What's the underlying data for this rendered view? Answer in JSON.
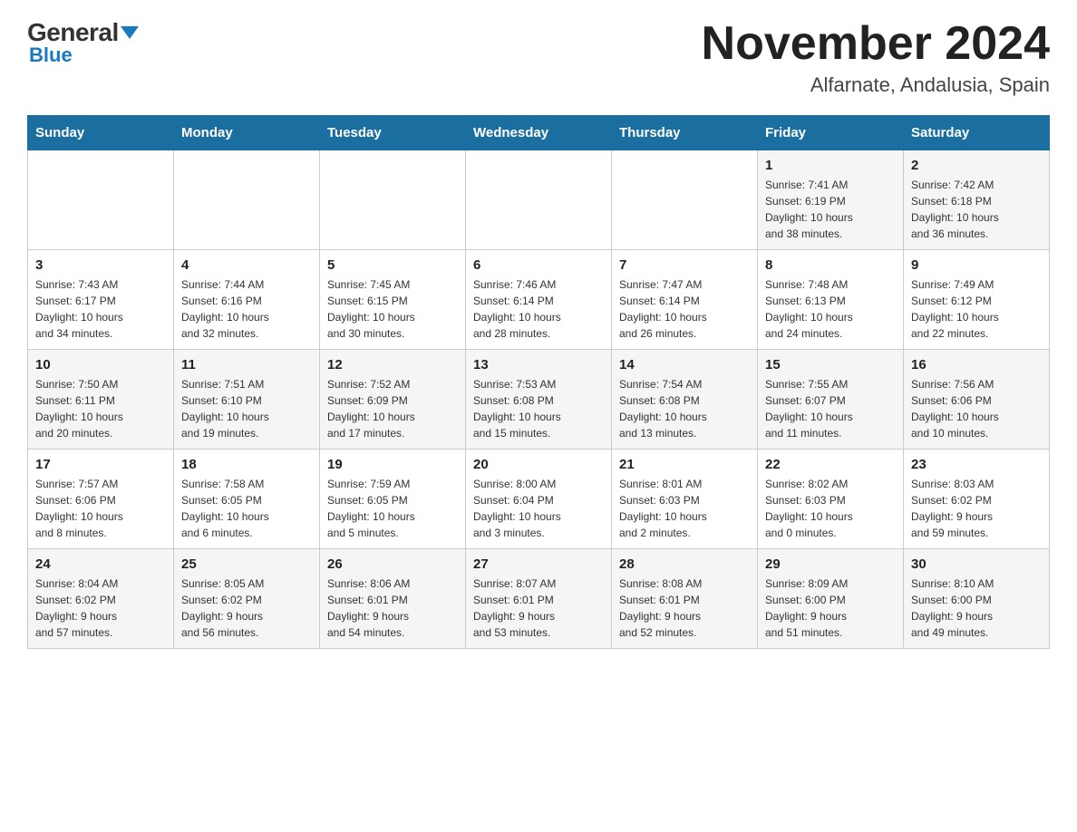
{
  "header": {
    "logo_top": "General",
    "logo_bottom": "Blue",
    "title": "November 2024",
    "subtitle": "Alfarnate, Andalusia, Spain"
  },
  "weekdays": [
    "Sunday",
    "Monday",
    "Tuesday",
    "Wednesday",
    "Thursday",
    "Friday",
    "Saturday"
  ],
  "weeks": [
    [
      {
        "day": "",
        "info": ""
      },
      {
        "day": "",
        "info": ""
      },
      {
        "day": "",
        "info": ""
      },
      {
        "day": "",
        "info": ""
      },
      {
        "day": "",
        "info": ""
      },
      {
        "day": "1",
        "info": "Sunrise: 7:41 AM\nSunset: 6:19 PM\nDaylight: 10 hours\nand 38 minutes."
      },
      {
        "day": "2",
        "info": "Sunrise: 7:42 AM\nSunset: 6:18 PM\nDaylight: 10 hours\nand 36 minutes."
      }
    ],
    [
      {
        "day": "3",
        "info": "Sunrise: 7:43 AM\nSunset: 6:17 PM\nDaylight: 10 hours\nand 34 minutes."
      },
      {
        "day": "4",
        "info": "Sunrise: 7:44 AM\nSunset: 6:16 PM\nDaylight: 10 hours\nand 32 minutes."
      },
      {
        "day": "5",
        "info": "Sunrise: 7:45 AM\nSunset: 6:15 PM\nDaylight: 10 hours\nand 30 minutes."
      },
      {
        "day": "6",
        "info": "Sunrise: 7:46 AM\nSunset: 6:14 PM\nDaylight: 10 hours\nand 28 minutes."
      },
      {
        "day": "7",
        "info": "Sunrise: 7:47 AM\nSunset: 6:14 PM\nDaylight: 10 hours\nand 26 minutes."
      },
      {
        "day": "8",
        "info": "Sunrise: 7:48 AM\nSunset: 6:13 PM\nDaylight: 10 hours\nand 24 minutes."
      },
      {
        "day": "9",
        "info": "Sunrise: 7:49 AM\nSunset: 6:12 PM\nDaylight: 10 hours\nand 22 minutes."
      }
    ],
    [
      {
        "day": "10",
        "info": "Sunrise: 7:50 AM\nSunset: 6:11 PM\nDaylight: 10 hours\nand 20 minutes."
      },
      {
        "day": "11",
        "info": "Sunrise: 7:51 AM\nSunset: 6:10 PM\nDaylight: 10 hours\nand 19 minutes."
      },
      {
        "day": "12",
        "info": "Sunrise: 7:52 AM\nSunset: 6:09 PM\nDaylight: 10 hours\nand 17 minutes."
      },
      {
        "day": "13",
        "info": "Sunrise: 7:53 AM\nSunset: 6:08 PM\nDaylight: 10 hours\nand 15 minutes."
      },
      {
        "day": "14",
        "info": "Sunrise: 7:54 AM\nSunset: 6:08 PM\nDaylight: 10 hours\nand 13 minutes."
      },
      {
        "day": "15",
        "info": "Sunrise: 7:55 AM\nSunset: 6:07 PM\nDaylight: 10 hours\nand 11 minutes."
      },
      {
        "day": "16",
        "info": "Sunrise: 7:56 AM\nSunset: 6:06 PM\nDaylight: 10 hours\nand 10 minutes."
      }
    ],
    [
      {
        "day": "17",
        "info": "Sunrise: 7:57 AM\nSunset: 6:06 PM\nDaylight: 10 hours\nand 8 minutes."
      },
      {
        "day": "18",
        "info": "Sunrise: 7:58 AM\nSunset: 6:05 PM\nDaylight: 10 hours\nand 6 minutes."
      },
      {
        "day": "19",
        "info": "Sunrise: 7:59 AM\nSunset: 6:05 PM\nDaylight: 10 hours\nand 5 minutes."
      },
      {
        "day": "20",
        "info": "Sunrise: 8:00 AM\nSunset: 6:04 PM\nDaylight: 10 hours\nand 3 minutes."
      },
      {
        "day": "21",
        "info": "Sunrise: 8:01 AM\nSunset: 6:03 PM\nDaylight: 10 hours\nand 2 minutes."
      },
      {
        "day": "22",
        "info": "Sunrise: 8:02 AM\nSunset: 6:03 PM\nDaylight: 10 hours\nand 0 minutes."
      },
      {
        "day": "23",
        "info": "Sunrise: 8:03 AM\nSunset: 6:02 PM\nDaylight: 9 hours\nand 59 minutes."
      }
    ],
    [
      {
        "day": "24",
        "info": "Sunrise: 8:04 AM\nSunset: 6:02 PM\nDaylight: 9 hours\nand 57 minutes."
      },
      {
        "day": "25",
        "info": "Sunrise: 8:05 AM\nSunset: 6:02 PM\nDaylight: 9 hours\nand 56 minutes."
      },
      {
        "day": "26",
        "info": "Sunrise: 8:06 AM\nSunset: 6:01 PM\nDaylight: 9 hours\nand 54 minutes."
      },
      {
        "day": "27",
        "info": "Sunrise: 8:07 AM\nSunset: 6:01 PM\nDaylight: 9 hours\nand 53 minutes."
      },
      {
        "day": "28",
        "info": "Sunrise: 8:08 AM\nSunset: 6:01 PM\nDaylight: 9 hours\nand 52 minutes."
      },
      {
        "day": "29",
        "info": "Sunrise: 8:09 AM\nSunset: 6:00 PM\nDaylight: 9 hours\nand 51 minutes."
      },
      {
        "day": "30",
        "info": "Sunrise: 8:10 AM\nSunset: 6:00 PM\nDaylight: 9 hours\nand 49 minutes."
      }
    ]
  ]
}
